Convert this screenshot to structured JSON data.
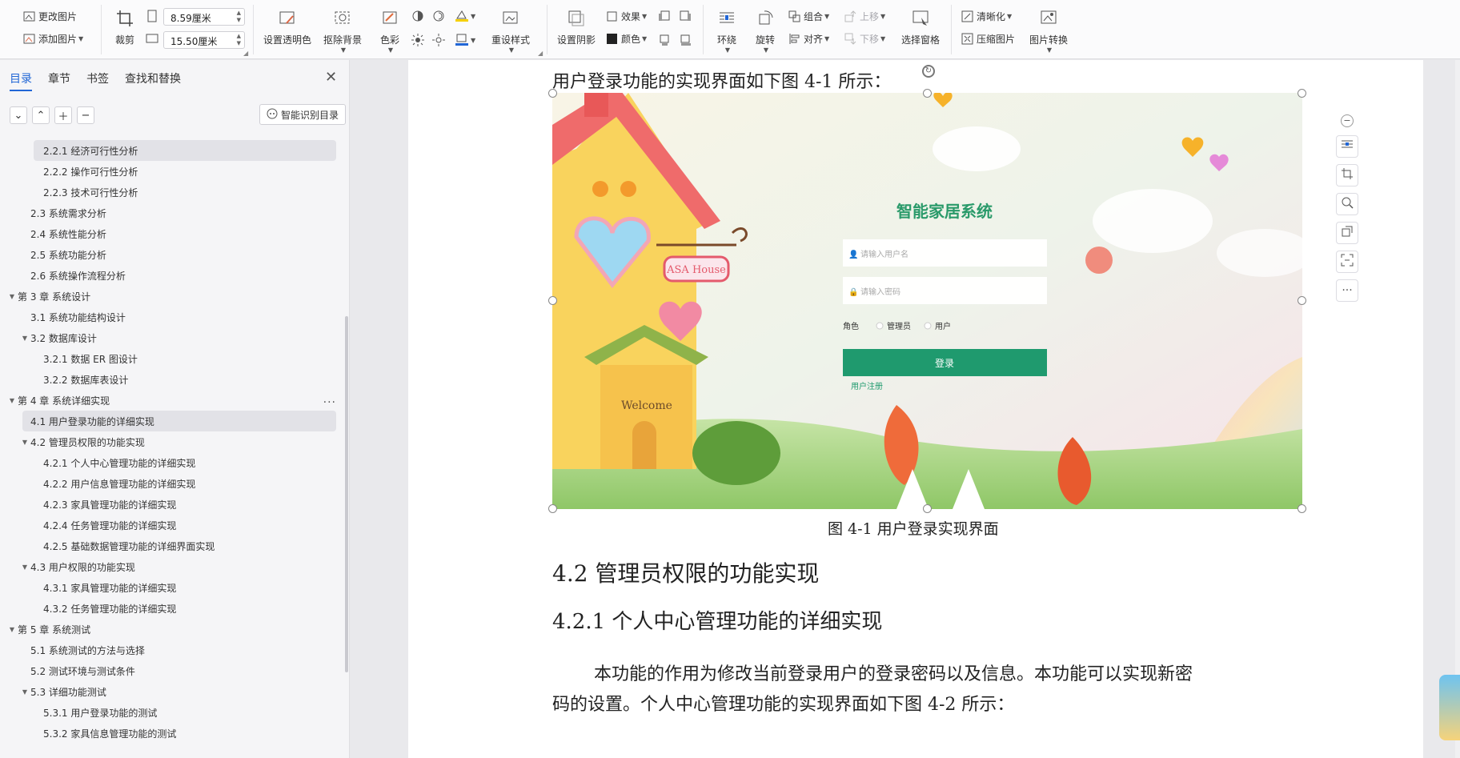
{
  "ribbon": {
    "change_image": "更改图片",
    "add_image": "添加图片",
    "crop": "裁剪",
    "width_value": "8.59厘米",
    "height_value": "15.50厘米",
    "set_transparent": "设置透明色",
    "remove_bg": "抠除背景",
    "color_tone": "色彩",
    "reset_style": "重设样式",
    "set_shadow": "设置阴影",
    "effect": "效果",
    "color": "颜色",
    "wrap": "环绕",
    "rotate": "旋转",
    "group": "组合",
    "align": "对齐",
    "bring_forward": "上移",
    "send_backward": "下移",
    "selection_pane": "选择窗格",
    "sharpen": "清晰化",
    "compress": "压缩图片",
    "convert": "图片转换"
  },
  "nav": {
    "tabs": [
      "目录",
      "章节",
      "书签",
      "查找和替换"
    ],
    "smart_toc": "智能识别目录",
    "items": [
      {
        "label": "2.2.1 经济可行性分析",
        "level": 3,
        "toggle": "",
        "selected": true
      },
      {
        "label": "2.2.2 操作可行性分析",
        "level": 3,
        "toggle": "",
        "selected": false
      },
      {
        "label": "2.2.3 技术可行性分析",
        "level": 3,
        "toggle": "",
        "selected": false
      },
      {
        "label": "2.3 系统需求分析",
        "level": 2,
        "toggle": "",
        "selected": false
      },
      {
        "label": "2.4 系统性能分析",
        "level": 2,
        "toggle": "",
        "selected": false
      },
      {
        "label": "2.5 系统功能分析",
        "level": 2,
        "toggle": "",
        "selected": false
      },
      {
        "label": "2.6 系统操作流程分析",
        "level": 2,
        "toggle": "",
        "selected": false
      },
      {
        "label": "第 3 章  系统设计",
        "level": 1,
        "toggle": "▼",
        "selected": false
      },
      {
        "label": "3.1 系统功能结构设计",
        "level": 2,
        "toggle": "",
        "selected": false
      },
      {
        "label": "3.2 数据库设计",
        "level": 2,
        "toggle": "▼",
        "selected": false
      },
      {
        "label": "3.2.1 数据 ER 图设计",
        "level": 3,
        "toggle": "",
        "selected": false
      },
      {
        "label": "3.2.2 数据库表设计",
        "level": 3,
        "toggle": "",
        "selected": false
      },
      {
        "label": "第 4 章  系统详细实现",
        "level": 1,
        "toggle": "▼",
        "selected": false,
        "more": "..."
      },
      {
        "label": "4.1 用户登录功能的详细实现",
        "level": 2,
        "toggle": "",
        "selected": true
      },
      {
        "label": "4.2 管理员权限的功能实现",
        "level": 2,
        "toggle": "▼",
        "selected": false
      },
      {
        "label": "4.2.1 个人中心管理功能的详细实现",
        "level": 3,
        "toggle": "",
        "selected": false
      },
      {
        "label": "4.2.2 用户信息管理功能的详细实现",
        "level": 3,
        "toggle": "",
        "selected": false
      },
      {
        "label": "4.2.3 家具管理功能的详细实现",
        "level": 3,
        "toggle": "",
        "selected": false
      },
      {
        "label": "4.2.4 任务管理功能的详细实现",
        "level": 3,
        "toggle": "",
        "selected": false
      },
      {
        "label": "4.2.5 基础数据管理功能的详细界面实现",
        "level": 3,
        "toggle": "",
        "selected": false
      },
      {
        "label": "4.3 用户权限的功能实现",
        "level": 2,
        "toggle": "▼",
        "selected": false
      },
      {
        "label": "4.3.1 家具管理功能的详细实现",
        "level": 3,
        "toggle": "",
        "selected": false
      },
      {
        "label": "4.3.2 任务管理功能的详细实现",
        "level": 3,
        "toggle": "",
        "selected": false
      },
      {
        "label": "第 5 章  系统测试",
        "level": 1,
        "toggle": "▼",
        "selected": false
      },
      {
        "label": "5.1 系统测试的方法与选择",
        "level": 2,
        "toggle": "",
        "selected": false
      },
      {
        "label": "5.2 测试环境与测试条件",
        "level": 2,
        "toggle": "",
        "selected": false
      },
      {
        "label": "5.3 详细功能测试",
        "level": 2,
        "toggle": "▼",
        "selected": false
      },
      {
        "label": "5.3.1 用户登录功能的测试",
        "level": 3,
        "toggle": "",
        "selected": false
      },
      {
        "label": "5.3.2 家具信息管理功能的测试",
        "level": 3,
        "toggle": "",
        "selected": false
      }
    ]
  },
  "doc": {
    "intro_line": "用户登录功能的实现界面如下图 4-1 所示：",
    "figure_caption": "图 4-1 用户登录实现界面",
    "heading_42": "4.2 管理员权限的功能实现",
    "heading_421": "4.2.1 个人中心管理功能的详细实现",
    "para_line1": "本功能的作用为修改当前登录用户的登录密码以及信息。本功能可以实现新密",
    "para_line2": "码的设置。个人中心管理功能的实现界面如下图 4-2 所示："
  },
  "figure": {
    "app_title": "智能家居系统",
    "username_placeholder": "请输入用户名",
    "password_placeholder": "请输入密码",
    "role_label": "角色",
    "role_admin": "管理员",
    "role_user": "用户",
    "login_button": "登录",
    "register_link": "用户注册",
    "sign_text": "ASA House",
    "door_text": "Welcome"
  },
  "colors": {
    "accent": "#2166d6",
    "login_green": "#1f9a6e",
    "title_green": "#2a9a6a"
  }
}
